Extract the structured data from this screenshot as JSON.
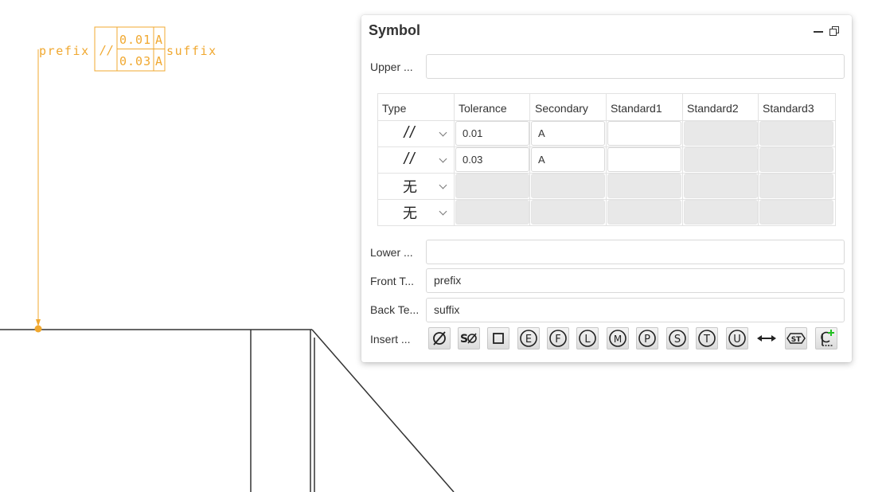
{
  "drawing": {
    "prefix": "prefix",
    "suffix": "suffix",
    "parallel_symbol": "//",
    "rows": [
      {
        "tolerance": "0.01",
        "datum": "A"
      },
      {
        "tolerance": "0.03",
        "datum": "A"
      }
    ],
    "annotation_color": "#f0a830",
    "line_color": "#333333"
  },
  "panel": {
    "title": "Symbol",
    "labels": {
      "upper": "Upper ...",
      "lower": "Lower ...",
      "front": "Front T...",
      "back": "Back Te...",
      "insert": "Insert ..."
    },
    "upper_value": "",
    "lower_value": "",
    "front_value": "prefix",
    "back_value": "suffix",
    "table": {
      "headers": [
        "Type",
        "Tolerance",
        "Secondary",
        "Standard1",
        "Standard2",
        "Standard3"
      ],
      "rows": [
        {
          "type": "//",
          "tolerance": "0.01",
          "secondary": "A",
          "standard1": ""
        },
        {
          "type": "//",
          "tolerance": "0.03",
          "secondary": "A",
          "standard1": ""
        },
        {
          "type": "无"
        },
        {
          "type": "无"
        }
      ]
    },
    "insert_symbols": [
      "diameter-icon",
      "spherical-diameter-icon",
      "square-icon",
      "circle-e-icon",
      "circle-f-icon",
      "circle-l-icon",
      "circle-m-icon",
      "circle-p-icon",
      "circle-s-icon",
      "circle-t-icon",
      "circle-u-icon",
      "double-arrow-icon",
      "statistical-icon",
      "centerline-add-icon"
    ],
    "insert_symbol_text": {
      "sphere_prefix": "S",
      "circled": [
        "E",
        "F",
        "L",
        "M",
        "P",
        "S",
        "T",
        "U"
      ],
      "statistical": "ST"
    }
  }
}
